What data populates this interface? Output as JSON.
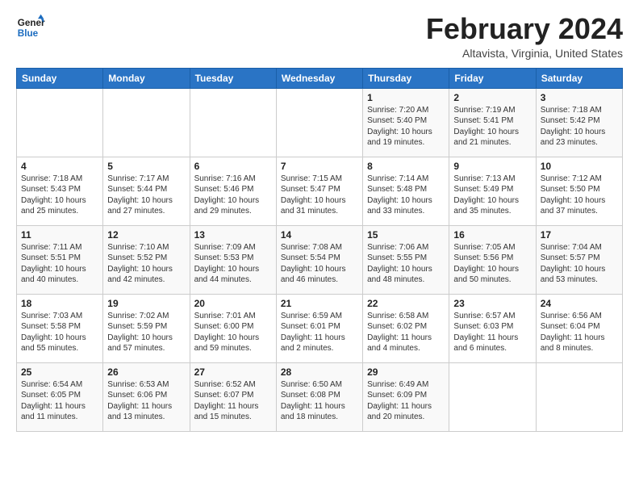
{
  "header": {
    "logo_general": "General",
    "logo_blue": "Blue",
    "month_title": "February 2024",
    "location": "Altavista, Virginia, United States"
  },
  "weekdays": [
    "Sunday",
    "Monday",
    "Tuesday",
    "Wednesday",
    "Thursday",
    "Friday",
    "Saturday"
  ],
  "weeks": [
    [
      {
        "day": "",
        "text": ""
      },
      {
        "day": "",
        "text": ""
      },
      {
        "day": "",
        "text": ""
      },
      {
        "day": "",
        "text": ""
      },
      {
        "day": "1",
        "text": "Sunrise: 7:20 AM\nSunset: 5:40 PM\nDaylight: 10 hours\nand 19 minutes."
      },
      {
        "day": "2",
        "text": "Sunrise: 7:19 AM\nSunset: 5:41 PM\nDaylight: 10 hours\nand 21 minutes."
      },
      {
        "day": "3",
        "text": "Sunrise: 7:18 AM\nSunset: 5:42 PM\nDaylight: 10 hours\nand 23 minutes."
      }
    ],
    [
      {
        "day": "4",
        "text": "Sunrise: 7:18 AM\nSunset: 5:43 PM\nDaylight: 10 hours\nand 25 minutes."
      },
      {
        "day": "5",
        "text": "Sunrise: 7:17 AM\nSunset: 5:44 PM\nDaylight: 10 hours\nand 27 minutes."
      },
      {
        "day": "6",
        "text": "Sunrise: 7:16 AM\nSunset: 5:46 PM\nDaylight: 10 hours\nand 29 minutes."
      },
      {
        "day": "7",
        "text": "Sunrise: 7:15 AM\nSunset: 5:47 PM\nDaylight: 10 hours\nand 31 minutes."
      },
      {
        "day": "8",
        "text": "Sunrise: 7:14 AM\nSunset: 5:48 PM\nDaylight: 10 hours\nand 33 minutes."
      },
      {
        "day": "9",
        "text": "Sunrise: 7:13 AM\nSunset: 5:49 PM\nDaylight: 10 hours\nand 35 minutes."
      },
      {
        "day": "10",
        "text": "Sunrise: 7:12 AM\nSunset: 5:50 PM\nDaylight: 10 hours\nand 37 minutes."
      }
    ],
    [
      {
        "day": "11",
        "text": "Sunrise: 7:11 AM\nSunset: 5:51 PM\nDaylight: 10 hours\nand 40 minutes."
      },
      {
        "day": "12",
        "text": "Sunrise: 7:10 AM\nSunset: 5:52 PM\nDaylight: 10 hours\nand 42 minutes."
      },
      {
        "day": "13",
        "text": "Sunrise: 7:09 AM\nSunset: 5:53 PM\nDaylight: 10 hours\nand 44 minutes."
      },
      {
        "day": "14",
        "text": "Sunrise: 7:08 AM\nSunset: 5:54 PM\nDaylight: 10 hours\nand 46 minutes."
      },
      {
        "day": "15",
        "text": "Sunrise: 7:06 AM\nSunset: 5:55 PM\nDaylight: 10 hours\nand 48 minutes."
      },
      {
        "day": "16",
        "text": "Sunrise: 7:05 AM\nSunset: 5:56 PM\nDaylight: 10 hours\nand 50 minutes."
      },
      {
        "day": "17",
        "text": "Sunrise: 7:04 AM\nSunset: 5:57 PM\nDaylight: 10 hours\nand 53 minutes."
      }
    ],
    [
      {
        "day": "18",
        "text": "Sunrise: 7:03 AM\nSunset: 5:58 PM\nDaylight: 10 hours\nand 55 minutes."
      },
      {
        "day": "19",
        "text": "Sunrise: 7:02 AM\nSunset: 5:59 PM\nDaylight: 10 hours\nand 57 minutes."
      },
      {
        "day": "20",
        "text": "Sunrise: 7:01 AM\nSunset: 6:00 PM\nDaylight: 10 hours\nand 59 minutes."
      },
      {
        "day": "21",
        "text": "Sunrise: 6:59 AM\nSunset: 6:01 PM\nDaylight: 11 hours\nand 2 minutes."
      },
      {
        "day": "22",
        "text": "Sunrise: 6:58 AM\nSunset: 6:02 PM\nDaylight: 11 hours\nand 4 minutes."
      },
      {
        "day": "23",
        "text": "Sunrise: 6:57 AM\nSunset: 6:03 PM\nDaylight: 11 hours\nand 6 minutes."
      },
      {
        "day": "24",
        "text": "Sunrise: 6:56 AM\nSunset: 6:04 PM\nDaylight: 11 hours\nand 8 minutes."
      }
    ],
    [
      {
        "day": "25",
        "text": "Sunrise: 6:54 AM\nSunset: 6:05 PM\nDaylight: 11 hours\nand 11 minutes."
      },
      {
        "day": "26",
        "text": "Sunrise: 6:53 AM\nSunset: 6:06 PM\nDaylight: 11 hours\nand 13 minutes."
      },
      {
        "day": "27",
        "text": "Sunrise: 6:52 AM\nSunset: 6:07 PM\nDaylight: 11 hours\nand 15 minutes."
      },
      {
        "day": "28",
        "text": "Sunrise: 6:50 AM\nSunset: 6:08 PM\nDaylight: 11 hours\nand 18 minutes."
      },
      {
        "day": "29",
        "text": "Sunrise: 6:49 AM\nSunset: 6:09 PM\nDaylight: 11 hours\nand 20 minutes."
      },
      {
        "day": "",
        "text": ""
      },
      {
        "day": "",
        "text": ""
      }
    ]
  ]
}
